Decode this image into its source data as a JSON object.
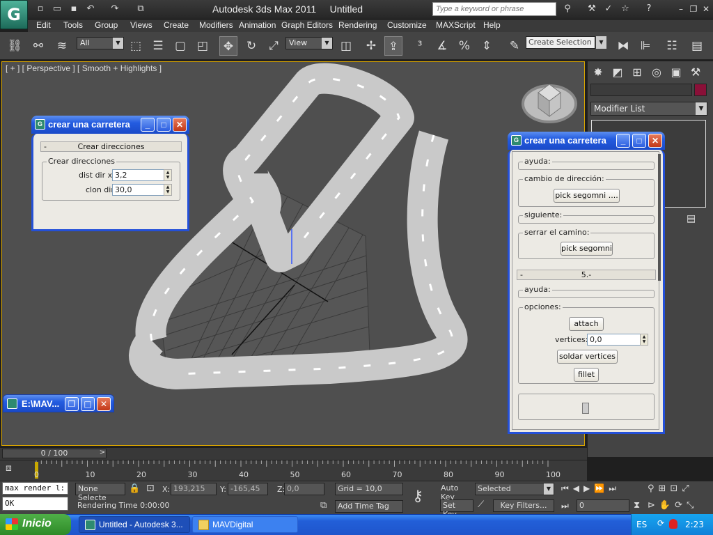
{
  "app": {
    "logo": "G",
    "title": "Autodesk 3ds Max  2011",
    "doc_title": "Untitled",
    "search_placeholder": "Type a keyword or phrase"
  },
  "menu": [
    "Edit",
    "Tools",
    "Group",
    "Views",
    "Create",
    "Modifiers",
    "Animation",
    "Graph Editors",
    "Rendering",
    "Customize",
    "MAXScript",
    "Help"
  ],
  "toolbar": {
    "filter_value": "All",
    "coord_value": "View",
    "selection_set": "Create Selection Se"
  },
  "viewport": {
    "label": "[ + ] [ Perspective ] [ Smooth + Highlights ]"
  },
  "command_panel": {
    "modifier_list": "Modifier List"
  },
  "dialog_left": {
    "title": "crear una carretera",
    "rollout": "Crear direcciones",
    "group": "Crear direcciones",
    "dist_label": "dist dir x",
    "dist_value": "3,2",
    "clon_label": "clon dir",
    "clon_value": "30,0"
  },
  "dialog_right": {
    "title": "crear una carretera",
    "ayuda1": "ayuda:",
    "cambio": "cambio de dirección:",
    "pick1": "pick segomni ....",
    "siguiente": "siguiente:",
    "serrar": "serrar el camino:",
    "pick2": "pick segomni",
    "rollout5": "5.-",
    "ayuda2": "ayuda:",
    "opciones": "opciones:",
    "attach": "attach",
    "vertices_label": "vertices:",
    "vertices_value": "0,0",
    "soldar": "soldar vertices",
    "fillet": "fillet"
  },
  "mini_window": {
    "title": "E:\\MAV..."
  },
  "timeline": {
    "slider": "0 / 100",
    "ticks": [
      "0",
      "10",
      "20",
      "30",
      "40",
      "50",
      "60",
      "70",
      "80",
      "90",
      "100"
    ]
  },
  "status": {
    "maxscript_input": "max render l:",
    "maxscript_output": "OK",
    "selection": "None Selecte",
    "x_label": "X:",
    "x_value": "193,215",
    "y_label": "Y:",
    "y_value": "-165,45",
    "z_label": "Z:",
    "z_value": "0,0",
    "grid": "Grid = 10,0",
    "rendering_time": "Rendering Time  0:00:00",
    "add_time_tag": "Add Time Tag",
    "auto_key": "Auto Key",
    "set_key": "Set Key",
    "key_mode": "Selected",
    "key_filters": "Key Filters...",
    "frame": "0"
  },
  "taskbar": {
    "start": "Inicio",
    "task1": "Untitled - Autodesk 3...",
    "task2": "MAVDigital",
    "lang": "ES",
    "clock": "2:23"
  }
}
